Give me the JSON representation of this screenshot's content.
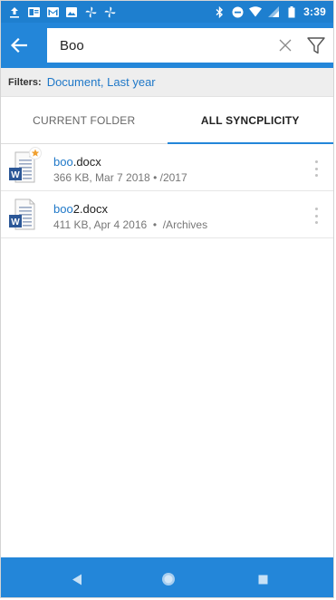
{
  "status_bar": {
    "time": "3:39",
    "left_icons": [
      "upload-icon",
      "outlook-icon",
      "gmail-icon",
      "image-icon",
      "pinwheel-icon",
      "pinwheel-icon"
    ],
    "right_icons": [
      "bluetooth-icon",
      "do-not-disturb-icon",
      "wifi-icon",
      "signal-icon",
      "battery-icon"
    ]
  },
  "toolbar": {
    "back_icon": "arrow-left-icon",
    "search_value": "Boo",
    "clear_icon": "close-icon",
    "filter_icon": "filter-icon"
  },
  "filters": {
    "label": "Filters:",
    "value": "Document, Last year"
  },
  "tabs": [
    {
      "label": "CURRENT FOLDER",
      "active": false
    },
    {
      "label": "ALL SYNCPLICITY",
      "active": true
    }
  ],
  "files": [
    {
      "name_match": "boo",
      "name_rest": ".docx",
      "meta": "366 KB, Mar 7 2018 • /2017",
      "starred": true,
      "icon": "word-document-icon"
    },
    {
      "name_match": "boo",
      "name_rest": "2.docx",
      "meta": "411 KB, Apr 4 2016  •  /Archives",
      "starred": false,
      "icon": "word-document-icon"
    }
  ],
  "nav_bar": {
    "back_icon": "nav-back-icon",
    "home_icon": "nav-home-icon",
    "recents_icon": "nav-recents-icon"
  },
  "colors": {
    "status_bar": "#1e7fcf",
    "toolbar": "#2386d9",
    "accent_text": "#1f78c8",
    "filters_bg": "#eeeeee",
    "word_blue": "#2b5797",
    "star": "#f0a030"
  }
}
